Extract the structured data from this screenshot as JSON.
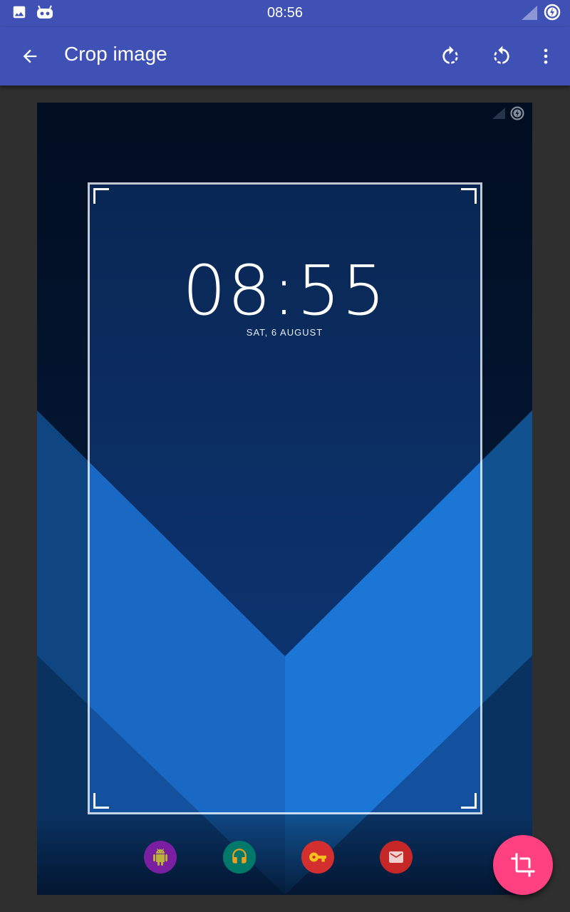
{
  "status_bar": {
    "time": "08:56",
    "left_icons": [
      "image-icon",
      "cyanogen-icon"
    ],
    "right_icons": [
      "signal-icon",
      "battery-charging-icon"
    ]
  },
  "app_bar": {
    "back_icon": "arrow-back-icon",
    "title": "Crop image",
    "actions": [
      "rotate-right-icon",
      "rotate-left-icon",
      "more-vert-icon"
    ]
  },
  "image": {
    "lock_time": "08:55",
    "lock_date": "SAT, 6 AUGUST",
    "status_icons": [
      "signal-icon",
      "battery-charging-icon"
    ],
    "dock_apps": [
      {
        "icon": "android-icon",
        "color": "#7b1fa2"
      },
      {
        "icon": "headphones-icon",
        "color": "#00796b"
      },
      {
        "icon": "key-icon",
        "color": "#d32f2f"
      },
      {
        "icon": "mail-icon",
        "color": "#c62828"
      }
    ]
  },
  "fab": {
    "icon": "crop-icon",
    "color": "#ff4081"
  },
  "colors": {
    "primary": "#3f51b5",
    "accent": "#ff4081",
    "canvas": "#2f2f2f"
  }
}
